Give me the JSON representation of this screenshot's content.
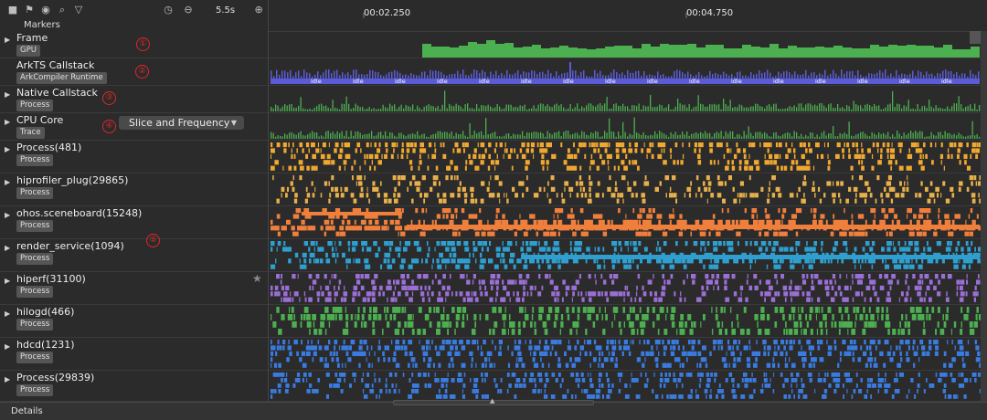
{
  "toolbar": {
    "zoom_label": "5.5s",
    "icons": [
      "stop-icon",
      "flag-icon",
      "chrome-icon",
      "search-icon",
      "filter-icon",
      "timer-icon",
      "zoom-out-icon",
      "zoom-in-icon"
    ]
  },
  "markers_label": "Markers",
  "ruler": {
    "labels": [
      "00:02.250",
      "00:04.750"
    ]
  },
  "rows": [
    {
      "title": "Frame",
      "badge": "GPU",
      "annotation": "①",
      "expander": true
    },
    {
      "title": "ArkTS Callstack",
      "badge": "ArkCompiler Runtime",
      "annotation": "②",
      "expander": false
    },
    {
      "title": "Native Callstack",
      "badge": "Process",
      "annotation": "③",
      "expander": true
    },
    {
      "title": "CPU Core",
      "badge": "Trace",
      "annotation": "④",
      "expander": true
    },
    {
      "title": "Process(481)",
      "badge": "Process",
      "annotation": "",
      "expander": true
    },
    {
      "title": "hiprofiler_plug(29865)",
      "badge": "Process",
      "annotation": "",
      "expander": true
    },
    {
      "title": "ohos.sceneboard(15248)",
      "badge": "Process",
      "annotation": "",
      "expander": true
    },
    {
      "title": "render_service(1094)",
      "badge": "Process",
      "annotation": "⑤",
      "expander": true
    },
    {
      "title": "hiperf(31100)",
      "badge": "Process",
      "annotation": "",
      "expander": true
    },
    {
      "title": "hilogd(466)",
      "badge": "Process",
      "annotation": "",
      "expander": true
    },
    {
      "title": "hdcd(1231)",
      "badge": "Process",
      "annotation": "",
      "expander": true
    },
    {
      "title": "Process(29839)",
      "badge": "Process",
      "annotation": "",
      "expander": true
    }
  ],
  "cpu_mode": {
    "selected": "Slice and Frequency"
  },
  "idle_label": "idle",
  "details_label": "Details",
  "colors": {
    "frame": "#4caf50",
    "ark": "#5b5bd6",
    "native": "#4caf50",
    "p481": "#f0a830",
    "hiprofiler": "#e8b04a",
    "sceneboard": "#f07f3c",
    "render": "#2f9fd0",
    "hiperf": "#9b6fd6",
    "hilogd": "#4caf50",
    "hdcd": "#3a7be0",
    "p29839": "#3a7be0"
  }
}
